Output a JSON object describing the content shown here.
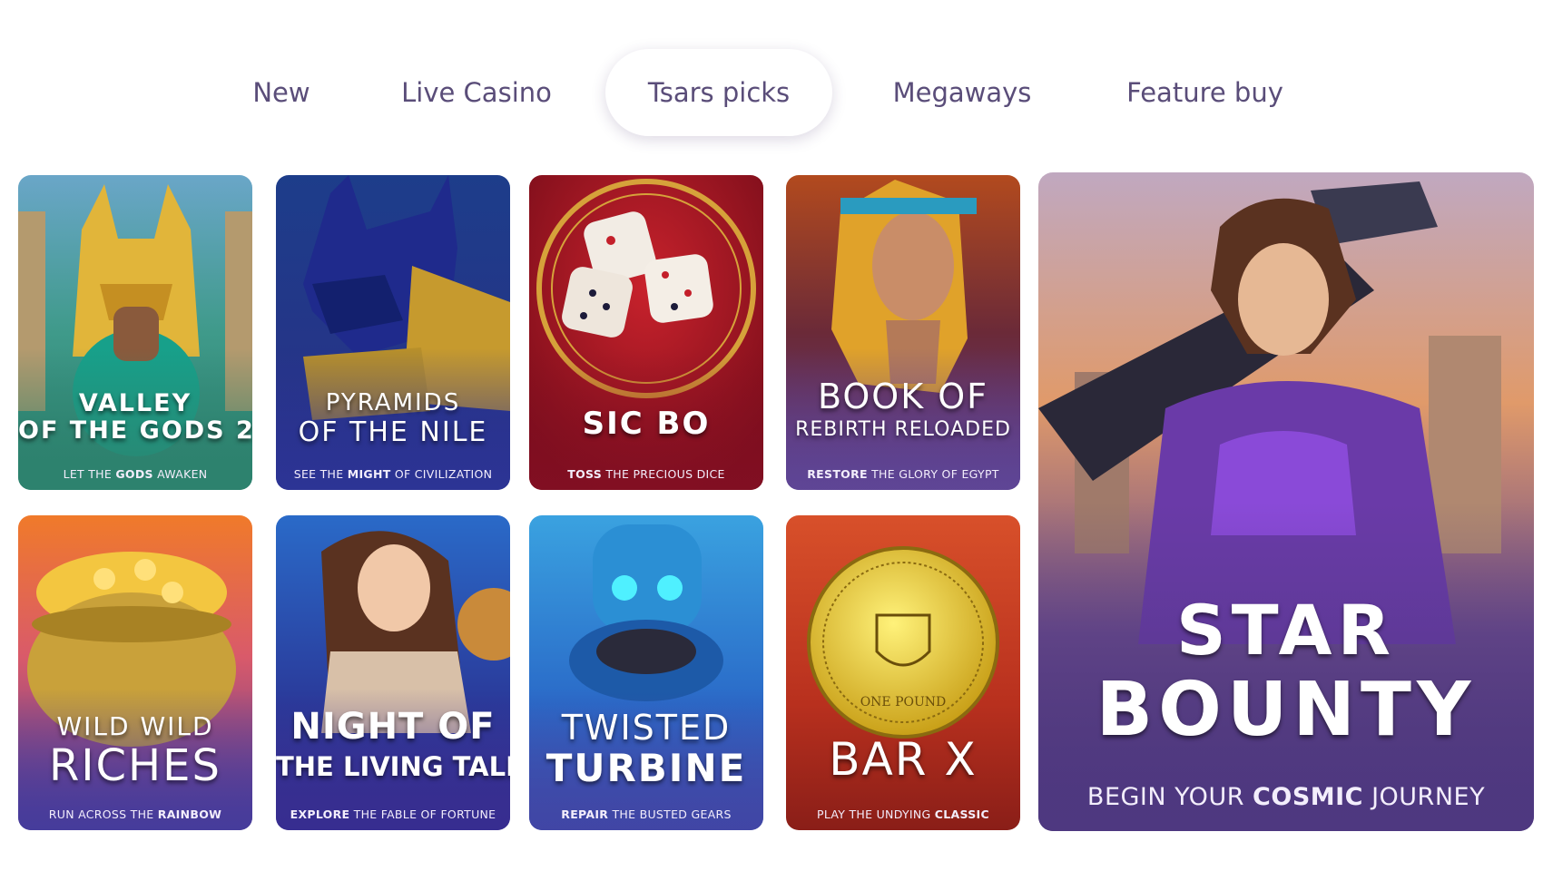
{
  "tabs": [
    {
      "label": "New",
      "active": false
    },
    {
      "label": "Live Casino",
      "active": false
    },
    {
      "label": "Tsars picks",
      "active": true
    },
    {
      "label": "Megaways",
      "active": false
    },
    {
      "label": "Feature buy",
      "active": false
    }
  ],
  "games": [
    {
      "title1": "VALLEY",
      "title2": "OF THE GODS 2",
      "tag_pre": "LET THE ",
      "tag_bold": "GODS",
      "tag_post": " AWAKEN"
    },
    {
      "title1": "PYRAMIDS",
      "title2": "OF THE NILE",
      "tag_pre": "SEE THE ",
      "tag_bold": "MIGHT",
      "tag_post": " OF CIVILIZATION"
    },
    {
      "title1": "SIC BO",
      "title2": "",
      "tag_pre": "",
      "tag_bold": "TOSS",
      "tag_post": " THE PRECIOUS DICE"
    },
    {
      "title1": "BOOK OF",
      "title2": "REBIRTH RELOADED",
      "tag_pre": "",
      "tag_bold": "RESTORE",
      "tag_post": " THE GLORY OF EGYPT"
    },
    {
      "title1": "WILD WILD",
      "title2": "RICHES",
      "tag_pre": "RUN ACROSS THE ",
      "tag_bold": "RAINBOW",
      "tag_post": ""
    },
    {
      "title1": "NIGHT OF",
      "title2": "THE LIVING TALES",
      "tag_pre": "",
      "tag_bold": "EXPLORE",
      "tag_post": " THE FABLE OF FORTUNE"
    },
    {
      "title1": "TWISTED",
      "title2": "TURBINE",
      "tag_pre": "",
      "tag_bold": "REPAIR",
      "tag_post": " THE BUSTED GEARS"
    },
    {
      "title1": "BAR X",
      "title2": "",
      "tag_pre": "PLAY THE UNDYING ",
      "tag_bold": "CLASSIC",
      "tag_post": ""
    }
  ],
  "featured": {
    "title1": "STAR",
    "title2": "BOUNTY",
    "tag_pre": "BEGIN YOUR ",
    "tag_bold": "COSMIC",
    "tag_post": " JOURNEY"
  },
  "coin_text": "ONE POUND"
}
